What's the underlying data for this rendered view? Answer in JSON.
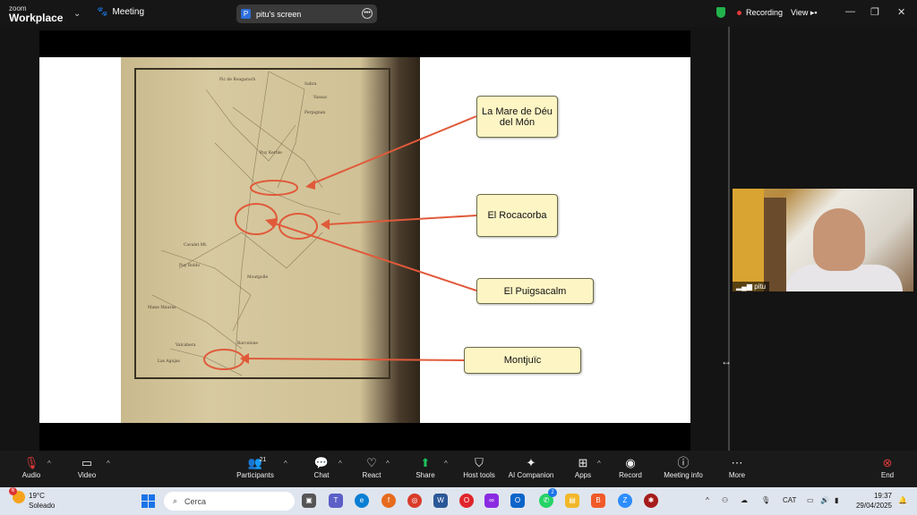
{
  "app": {
    "logo_small": "zoom",
    "logo_big": "Workplace",
    "meeting_label": "Meeting",
    "screen_label": "pitu's screen",
    "screen_initial": "P",
    "recording_label": "Recording",
    "view_label": "View"
  },
  "slide": {
    "notes": [
      "La Mare de Déu del Món",
      "El Rocacorba",
      "El Puigsacalm",
      "Montjuïc"
    ],
    "annotation_color": "#e05a3a",
    "note_bg": "#fdf5c4"
  },
  "video": {
    "participant_name": "pitu"
  },
  "toolbar": {
    "audio": "Audio",
    "video": "Video",
    "participants": "Participants",
    "participants_count": "21",
    "chat": "Chat",
    "react": "React",
    "share": "Share",
    "host_tools": "Host tools",
    "ai_companion": "AI Companion",
    "apps": "Apps",
    "record": "Record",
    "meeting_info": "Meeting info",
    "more": "More",
    "end": "End"
  },
  "taskbar": {
    "temperature": "19°C",
    "weather": "Soleado",
    "weather_badge": "6",
    "search_placeholder": "Cerca",
    "whatsapp_badge": "2",
    "language": "CAT",
    "time": "19:37",
    "date": "29/04/2025"
  }
}
